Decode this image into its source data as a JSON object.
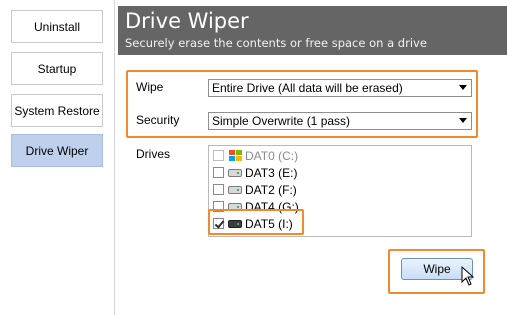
{
  "sidebar": {
    "items": [
      {
        "label": "Uninstall"
      },
      {
        "label": "Startup"
      },
      {
        "label": "System Restore"
      },
      {
        "label": "Drive Wiper",
        "active": true
      }
    ]
  },
  "header": {
    "title": "Drive Wiper",
    "subtitle": "Securely erase the contents or free space on a drive"
  },
  "form": {
    "wipe_label": "Wipe",
    "wipe_value": "Entire Drive (All data will be erased)",
    "security_label": "Security",
    "security_value": "Simple Overwrite (1 pass)",
    "drives_label": "Drives"
  },
  "drives": [
    {
      "label": "DAT0 (C:)",
      "checked": false,
      "disabled": true,
      "icon": "windows-drive-icon"
    },
    {
      "label": "DAT3 (E:)",
      "checked": false,
      "disabled": false,
      "icon": "drive-icon"
    },
    {
      "label": "DAT2 (F:)",
      "checked": false,
      "disabled": false,
      "icon": "drive-icon"
    },
    {
      "label": "DAT4 (G:)",
      "checked": false,
      "disabled": false,
      "icon": "drive-icon"
    },
    {
      "label": "DAT5 (I:)",
      "checked": true,
      "disabled": false,
      "icon": "usb-drive-icon"
    }
  ],
  "actions": {
    "wipe_button": "Wipe"
  },
  "colors": {
    "header_bg": "#656565",
    "active_sidebar": "#bed0ec",
    "highlight": "#f08a2c"
  }
}
